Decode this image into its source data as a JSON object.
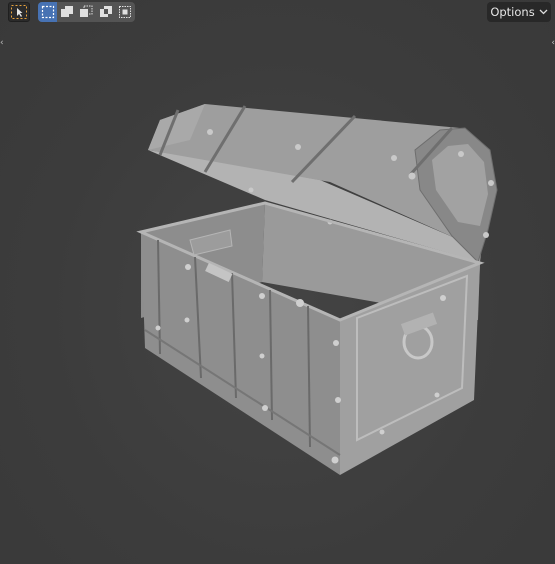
{
  "header": {
    "options_label": "Options"
  },
  "icons": {
    "select_tool": "cursor-select-icon",
    "mode_new": "select-new-icon",
    "mode_extend": "select-extend-icon",
    "mode_subtract": "select-subtract-icon",
    "mode_difference": "select-difference-icon",
    "mode_intersect": "select-intersect-icon",
    "options_chevron": "chevron-down-icon"
  },
  "colors": {
    "viewport_bg": "#3d3d3d",
    "active_accent": "#4772b3",
    "tool_outline": "#e8a33c"
  }
}
